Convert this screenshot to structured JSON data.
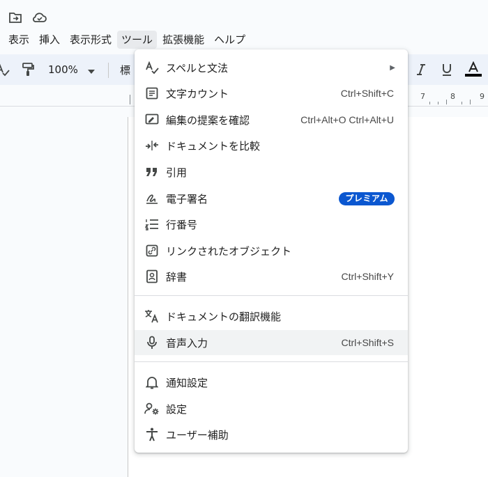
{
  "menubar": {
    "items": [
      "表示",
      "挿入",
      "表示形式",
      "ツール",
      "拡張機能",
      "ヘルプ"
    ],
    "active_index": 3
  },
  "toolbar": {
    "zoom": "100%",
    "style_partial": "標"
  },
  "ruler": {
    "numbers": [
      "7",
      "8",
      "9"
    ]
  },
  "menu": {
    "items": [
      {
        "label": "スペルと文法",
        "shortcut": "",
        "submenu": true
      },
      {
        "label": "文字カウント",
        "shortcut": "Ctrl+Shift+C"
      },
      {
        "label": "編集の提案を確認",
        "shortcut": "Ctrl+Alt+O Ctrl+Alt+U"
      },
      {
        "label": "ドキュメントを比較",
        "shortcut": ""
      },
      {
        "label": "引用",
        "shortcut": ""
      },
      {
        "label": "電子署名",
        "badge": "プレミアム"
      },
      {
        "label": "行番号",
        "shortcut": ""
      },
      {
        "label": "リンクされたオブジェクト",
        "shortcut": ""
      },
      {
        "label": "辞書",
        "shortcut": "Ctrl+Shift+Y"
      },
      {
        "label": "ドキュメントの翻訳機能",
        "shortcut": ""
      },
      {
        "label": "音声入力",
        "shortcut": "Ctrl+Shift+S",
        "highlighted": true
      },
      {
        "label": "通知設定",
        "shortcut": ""
      },
      {
        "label": "設定",
        "shortcut": ""
      },
      {
        "label": "ユーザー補助",
        "shortcut": ""
      }
    ]
  },
  "icons": {
    "menu": [
      "spellcheck-icon",
      "word-count-icon",
      "review-edits-icon",
      "compare-icon",
      "citation-icon",
      "signature-icon",
      "line-numbers-icon",
      "link-icon",
      "dictionary-icon",
      "translate-icon",
      "mic-icon",
      "bell-icon",
      "settings-icon",
      "accessibility-icon"
    ]
  },
  "colors": {
    "accent": "#0b57d0",
    "highlight": "#f1f3f4",
    "toolbar": "#edf2fa"
  }
}
